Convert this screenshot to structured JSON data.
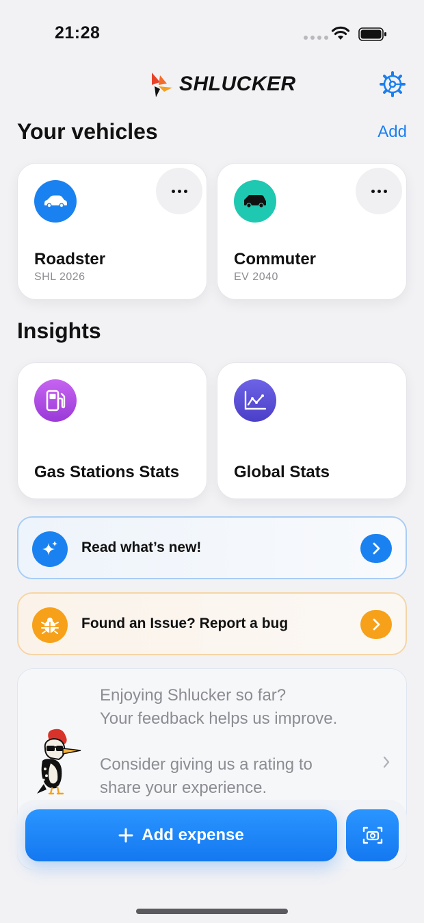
{
  "status_bar": {
    "time": "21:28"
  },
  "header": {
    "app_name": "SHLUCKER"
  },
  "vehicles_section": {
    "title": "Your vehicles",
    "add_label": "Add"
  },
  "vehicles": [
    {
      "name": "Roadster",
      "plate": "SHL 2026",
      "icon": "car-icon",
      "color": "#1a82f0"
    },
    {
      "name": "Commuter",
      "plate": "EV 2040",
      "icon": "suv-icon",
      "color": "#1fc8b0"
    }
  ],
  "insights_section": {
    "title": "Insights"
  },
  "insights": [
    {
      "label": "Gas Stations Stats",
      "icon": "fuel-pump-icon",
      "color": "#b44be6"
    },
    {
      "label": "Global Stats",
      "icon": "line-chart-icon",
      "color": "#5a4fd8"
    }
  ],
  "banners": {
    "whats_new": {
      "label": "Read what’s new!",
      "icon": "sparkles-icon",
      "color": "#1a82f0"
    },
    "bug_report": {
      "label": "Found an Issue? Report a bug",
      "icon": "bug-icon",
      "color": "#f7a11a"
    }
  },
  "feedback": {
    "line1": "Enjoying Shlucker so far?",
    "line2": "Your feedback helps us improve.",
    "line3": "Consider giving us a rating to",
    "line4": "share your experience."
  },
  "actions": {
    "add_expense_label": "Add expense"
  }
}
